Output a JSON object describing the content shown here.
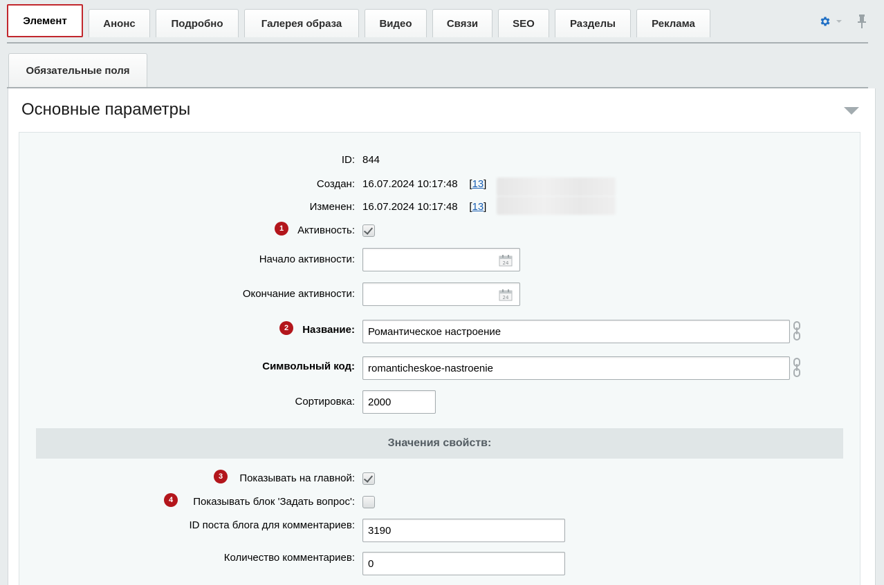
{
  "tabs": [
    {
      "label": "Элемент",
      "active": true
    },
    {
      "label": "Анонс"
    },
    {
      "label": "Подробно"
    },
    {
      "label": "Галерея образа"
    },
    {
      "label": "Видео"
    },
    {
      "label": "Связи"
    },
    {
      "label": "SEO"
    },
    {
      "label": "Разделы"
    },
    {
      "label": "Реклама"
    }
  ],
  "subtab": {
    "label": "Обязательные поля"
  },
  "section": {
    "title": "Основные параметры"
  },
  "fields": {
    "id": {
      "label": "ID:",
      "value": "844"
    },
    "created": {
      "label": "Создан:",
      "value": "16.07.2024 10:17:48",
      "user_open": "[",
      "user_id": "13",
      "user_close": "]"
    },
    "modified": {
      "label": "Изменен:",
      "value": "16.07.2024 10:17:48",
      "user_open": "[",
      "user_id": "13",
      "user_close": "]"
    },
    "active": {
      "badge": "1",
      "label": "Активность:",
      "checked": true
    },
    "active_from": {
      "label": "Начало активности:",
      "value": ""
    },
    "active_to": {
      "label": "Окончание активности:",
      "value": ""
    },
    "name": {
      "badge": "2",
      "label": "Название:",
      "value": "Романтическое настроение"
    },
    "code": {
      "label": "Символьный код:",
      "value": "romanticheskoe-nastroenie"
    },
    "sort": {
      "label": "Сортировка:",
      "value": "2000"
    }
  },
  "properties": {
    "header": "Значения свойств:",
    "show_main": {
      "badge": "3",
      "label": "Показывать на главной:",
      "checked": true
    },
    "show_question": {
      "badge": "4",
      "label": "Показывать блок 'Задать вопрос':",
      "checked": false
    },
    "blog_post_id": {
      "label": "ID поста блога для комментариев:",
      "value": "3190"
    },
    "comments_count": {
      "label": "Количество комментариев:",
      "value": "0"
    }
  },
  "calendar_day": "24",
  "colors": {
    "accent": "#c1272d",
    "badge": "#b3161c",
    "link": "#1a5fb4",
    "gear": "#1f6fc5"
  },
  "icons": {
    "settings": "gear-icon",
    "pin": "pin-icon",
    "calendar": "calendar-icon",
    "link": "chain-link-icon"
  }
}
